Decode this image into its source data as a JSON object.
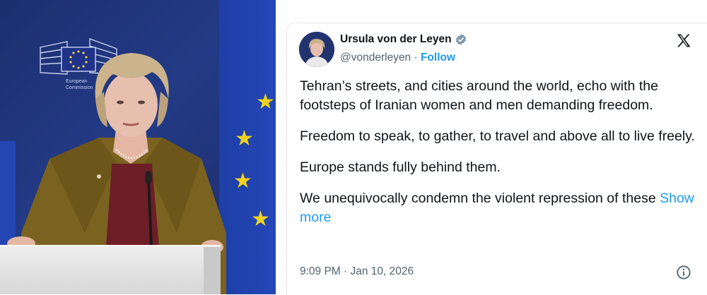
{
  "tweet": {
    "author_name": "Ursula von der Leyen",
    "verified": true,
    "handle": "@vonderleyen",
    "separator": " · ",
    "follow_label": "Follow",
    "paragraphs": [
      "Tehran’s streets, and cities around the world, echo with the footsteps of Iranian women and men demanding freedom.",
      "Freedom to speak, to gather, to travel and above all to live freely.",
      "Europe stands fully behind them."
    ],
    "last_paragraph": "We unequivocally condemn the violent repression of these",
    "show_more_label": "Show more",
    "timestamp": "9:09 PM · Jan 10, 2026",
    "platform_icon": "x-logo-icon",
    "info_icon": "info-icon"
  },
  "photo": {
    "logo_line1": "European",
    "logo_line2": "Commission"
  },
  "colors": {
    "link": "#1d9bf0",
    "text": "#0f1419",
    "secondary": "#536471",
    "eu_blue": "#2547b8",
    "eu_gold": "#f2d21b"
  }
}
